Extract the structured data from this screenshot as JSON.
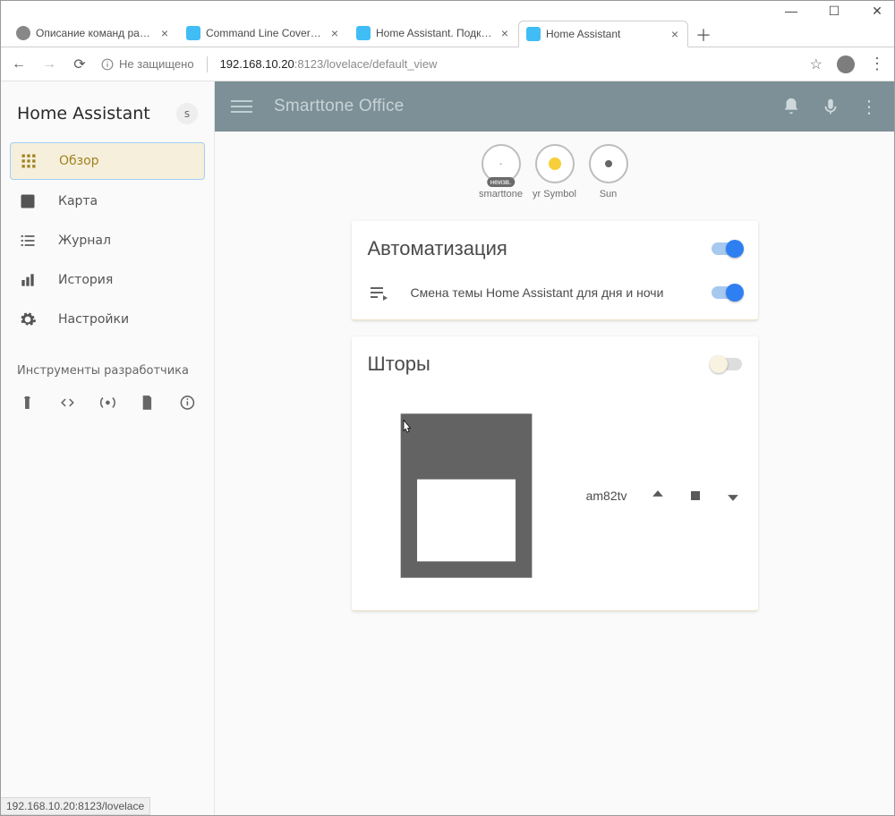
{
  "window": {
    "btn_min": "—",
    "btn_max": "☐",
    "btn_close": "✕"
  },
  "tabs": {
    "t0": "Описание команд радиом",
    "t1": "Command Line Cover - Hom",
    "t2": "Home Assistant. Подключе",
    "t3": "Home Assistant"
  },
  "address": {
    "not_secure": "Не защищено",
    "url_host": "192.168.10.20",
    "url_port_path": ":8123/lovelace/default_view"
  },
  "sidebar": {
    "title": "Home Assistant",
    "avatar_letter": "s",
    "items": [
      {
        "label": "Обзор"
      },
      {
        "label": "Карта"
      },
      {
        "label": "Журнал"
      },
      {
        "label": "История"
      },
      {
        "label": "Настройки"
      }
    ],
    "dev_section": "Инструменты разработчика"
  },
  "topbar": {
    "title": "Smarttone Office"
  },
  "badges": {
    "b0": {
      "label": "smarttone",
      "inner": "-",
      "tag": "неизв."
    },
    "b1": {
      "label": "yr Symbol"
    },
    "b2": {
      "label": "Sun"
    }
  },
  "cards": {
    "automation": {
      "title": "Автоматизация",
      "row0": "Смена темы Home Assistant для дня и ночи"
    },
    "covers": {
      "title": "Шторы",
      "row0": "am82tv"
    }
  },
  "status": "192.168.10.20:8123/lovelace"
}
